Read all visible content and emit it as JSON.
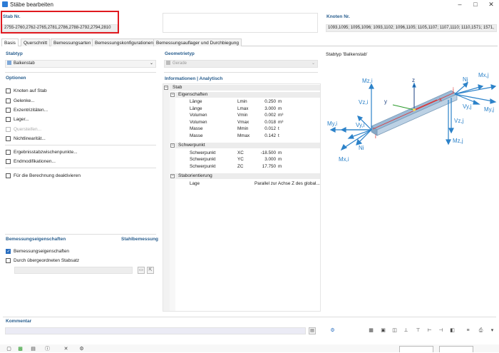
{
  "window": {
    "title": "Stäbe bearbeiten"
  },
  "header": {
    "stab_label": "Stab Nr.",
    "stab_value": "2755-2760,2762-2765,2781,2786,2788-2792,2794,2810",
    "knoten_label": "Knoten Nr.",
    "knoten_value": "1093,1095; 1095,1096; 1093,1102; 1096,1105; 1105,1107; 1107,1110; 1110,1571; 1571,"
  },
  "tabs": [
    "Basis",
    "Querschnitt",
    "Bemessungsarten",
    "Bemessungskonfigurationen",
    "Bemessungsauflager und Durchbiegung"
  ],
  "left": {
    "stabtyp_label": "Stabtyp",
    "stabtyp_value": "Balkenstab",
    "optionen_label": "Optionen",
    "options": [
      {
        "label": "Knoten auf Stab",
        "checked": false,
        "disabled": false
      },
      {
        "label": "Gelenke...",
        "checked": false,
        "disabled": false
      },
      {
        "label": "Exzentrizitäten...",
        "checked": false,
        "disabled": false
      },
      {
        "label": "Lager...",
        "checked": false,
        "disabled": false
      },
      {
        "label": "Quersteifen...",
        "checked": false,
        "disabled": true
      },
      {
        "label": "Nichtlinearität...",
        "checked": false,
        "disabled": false
      },
      {
        "label": "Ergebnisstabzwischenpunkte...",
        "checked": false,
        "disabled": false
      },
      {
        "label": "Endmodifikationen...",
        "checked": false,
        "disabled": false
      },
      {
        "label": "Für die Berechnung deaktivieren",
        "checked": false,
        "disabled": false
      }
    ],
    "bem_label": "Bemessungseigenschaften",
    "bem_right": "Stahlbemessung",
    "bem_options": [
      {
        "label": "Bemessungseigenschaften",
        "checked": true
      },
      {
        "label": "Durch übergeordneten Stabsatz",
        "checked": false
      }
    ]
  },
  "middle": {
    "geom_label": "Geometrietyp",
    "geom_value": "Gerade",
    "info_label": "Informationen | Analytisch",
    "root": "Stab",
    "groups": [
      {
        "name": "Eigenschaften",
        "rows": [
          {
            "name": "Länge",
            "sym": "Lmin",
            "val": "0.250",
            "unit": "m"
          },
          {
            "name": "Länge",
            "sym": "Lmax",
            "val": "3.000",
            "unit": "m"
          },
          {
            "name": "Volumen",
            "sym": "Vmin",
            "val": "0.002",
            "unit": "m³"
          },
          {
            "name": "Volumen",
            "sym": "Vmax",
            "val": "0.018",
            "unit": "m³"
          },
          {
            "name": "Masse",
            "sym": "Mmin",
            "val": "0.012",
            "unit": "t"
          },
          {
            "name": "Masse",
            "sym": "Mmax",
            "val": "0.142",
            "unit": "t"
          }
        ]
      },
      {
        "name": "Schwerpunkt",
        "rows": [
          {
            "name": "Schwerpunkt",
            "sym": "XC",
            "val": "-18.500",
            "unit": "m"
          },
          {
            "name": "Schwerpunkt",
            "sym": "YC",
            "val": "3.000",
            "unit": "m"
          },
          {
            "name": "Schwerpunkt",
            "sym": "ZC",
            "val": "17.750",
            "unit": "m"
          }
        ]
      },
      {
        "name": "Staborientierung",
        "rows": [
          {
            "name": "Lage",
            "sym": "",
            "val": "Parallel zur Achse Z des global...",
            "unit": ""
          }
        ]
      }
    ]
  },
  "right": {
    "preview_label": "Stabtyp 'Balkenstab'",
    "labels": {
      "mzi": "Mz,i",
      "ni": "Ni",
      "nj": "Nj",
      "mxj": "Mx,j",
      "vzi": "Vz,i",
      "vyj": "Vy,j",
      "myj": "My,j",
      "myi": "My,i",
      "vyi": "Vy,i",
      "vzj": "Vz,j",
      "mzj": "Mz,j",
      "mxi": "Mx,i",
      "z": "z",
      "y": "y",
      "x": "x",
      "i": "i",
      "j": "j"
    }
  },
  "comment": {
    "label": "Kommentar"
  },
  "colors": {
    "accent": "#2a6ebf",
    "header_text": "#2a5f8f",
    "highlight": "#e0191f",
    "beam": "#9bbad6"
  }
}
